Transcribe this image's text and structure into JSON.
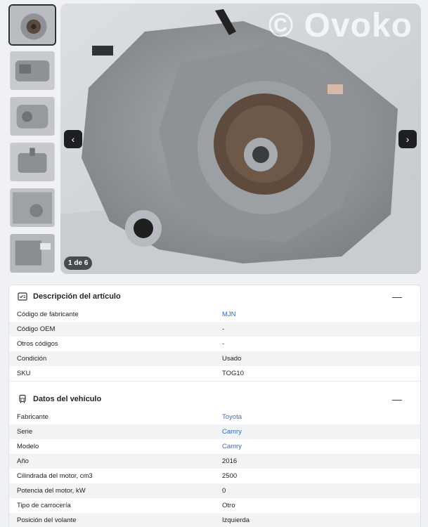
{
  "gallery": {
    "watermark": "© Ovoko",
    "counter": "1 de 6",
    "prev_icon": "chevron-left-icon",
    "next_icon": "chevron-right-icon",
    "thumbnail_count": 6
  },
  "description": {
    "title": "Descripción del artículo",
    "icon": "checklist-icon",
    "rows": [
      {
        "label": "Código de fabricante",
        "value": "MJN",
        "link": true
      },
      {
        "label": "Código OEM",
        "value": "-",
        "link": false
      },
      {
        "label": "Otros códigos",
        "value": "-",
        "link": false
      },
      {
        "label": "Condición",
        "value": "Usado",
        "link": false
      },
      {
        "label": "SKU",
        "value": "TOG10",
        "link": false
      }
    ]
  },
  "vehicle": {
    "title": "Datos del vehículo",
    "icon": "car-icon",
    "rows": [
      {
        "label": "Fabricante",
        "value": "Toyota",
        "link": true
      },
      {
        "label": "Serie",
        "value": "Camry",
        "link": true
      },
      {
        "label": "Modelo",
        "value": "Camry",
        "link": true
      },
      {
        "label": "Año",
        "value": "2016",
        "link": false
      },
      {
        "label": "Cilindrada del motor, cm3",
        "value": "2500",
        "link": false
      },
      {
        "label": "Potencia del motor, kW",
        "value": "0",
        "link": false
      },
      {
        "label": "Tipo de carrocería",
        "value": "Otro",
        "link": false
      },
      {
        "label": "Posición del volante",
        "value": "Izquierda",
        "link": false
      }
    ]
  },
  "colors": {
    "link": "#2d6ec8",
    "accent": "#1d1f22"
  }
}
